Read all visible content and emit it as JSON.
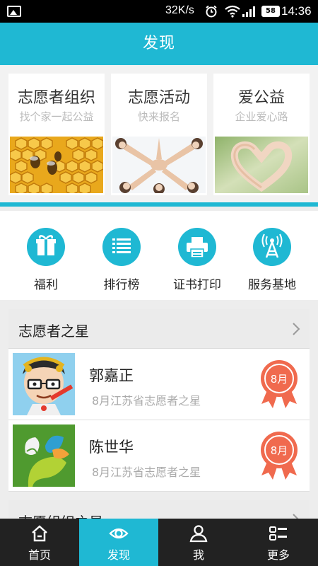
{
  "status_bar": {
    "speed": "32K/s",
    "battery": "58",
    "time": "14:36"
  },
  "header": {
    "title": "发现"
  },
  "cards": [
    {
      "title": "志愿者组织",
      "subtitle": "找个家一起公益",
      "image": "honeycomb-bees"
    },
    {
      "title": "志愿活动",
      "subtitle": "快来报名",
      "image": "hands-together-group"
    },
    {
      "title": "爱公益",
      "subtitle": "企业爱心路",
      "image": "heart-hands"
    }
  ],
  "features": [
    {
      "label": "福利",
      "icon": "gift-icon"
    },
    {
      "label": "排行榜",
      "icon": "list-icon"
    },
    {
      "label": "证书打印",
      "icon": "printer-icon"
    },
    {
      "label": "服务基地",
      "icon": "tower-icon"
    }
  ],
  "star_section": {
    "title": "志愿者之星",
    "rows": [
      {
        "name": "郭嘉正",
        "desc": "8月江苏省志愿者之星",
        "badge": "8月",
        "avatar": "cartoon-man-avatar"
      },
      {
        "name": "陈世华",
        "desc": "8月江苏省志愿者之星",
        "badge": "8月",
        "avatar": "green-leaf-logo-avatar"
      }
    ]
  },
  "org_section": {
    "title": "志愿组织之星"
  },
  "bottom_nav": {
    "items": [
      {
        "label": "首页",
        "icon": "home-icon",
        "active": false
      },
      {
        "label": "发现",
        "icon": "eye-icon",
        "active": true
      },
      {
        "label": "我",
        "icon": "person-icon",
        "active": false
      },
      {
        "label": "更多",
        "icon": "grid-more-icon",
        "active": false
      }
    ]
  },
  "colors": {
    "accent": "#1fb8d3",
    "badge": "#f06a4e",
    "nav_bg": "#222222"
  }
}
